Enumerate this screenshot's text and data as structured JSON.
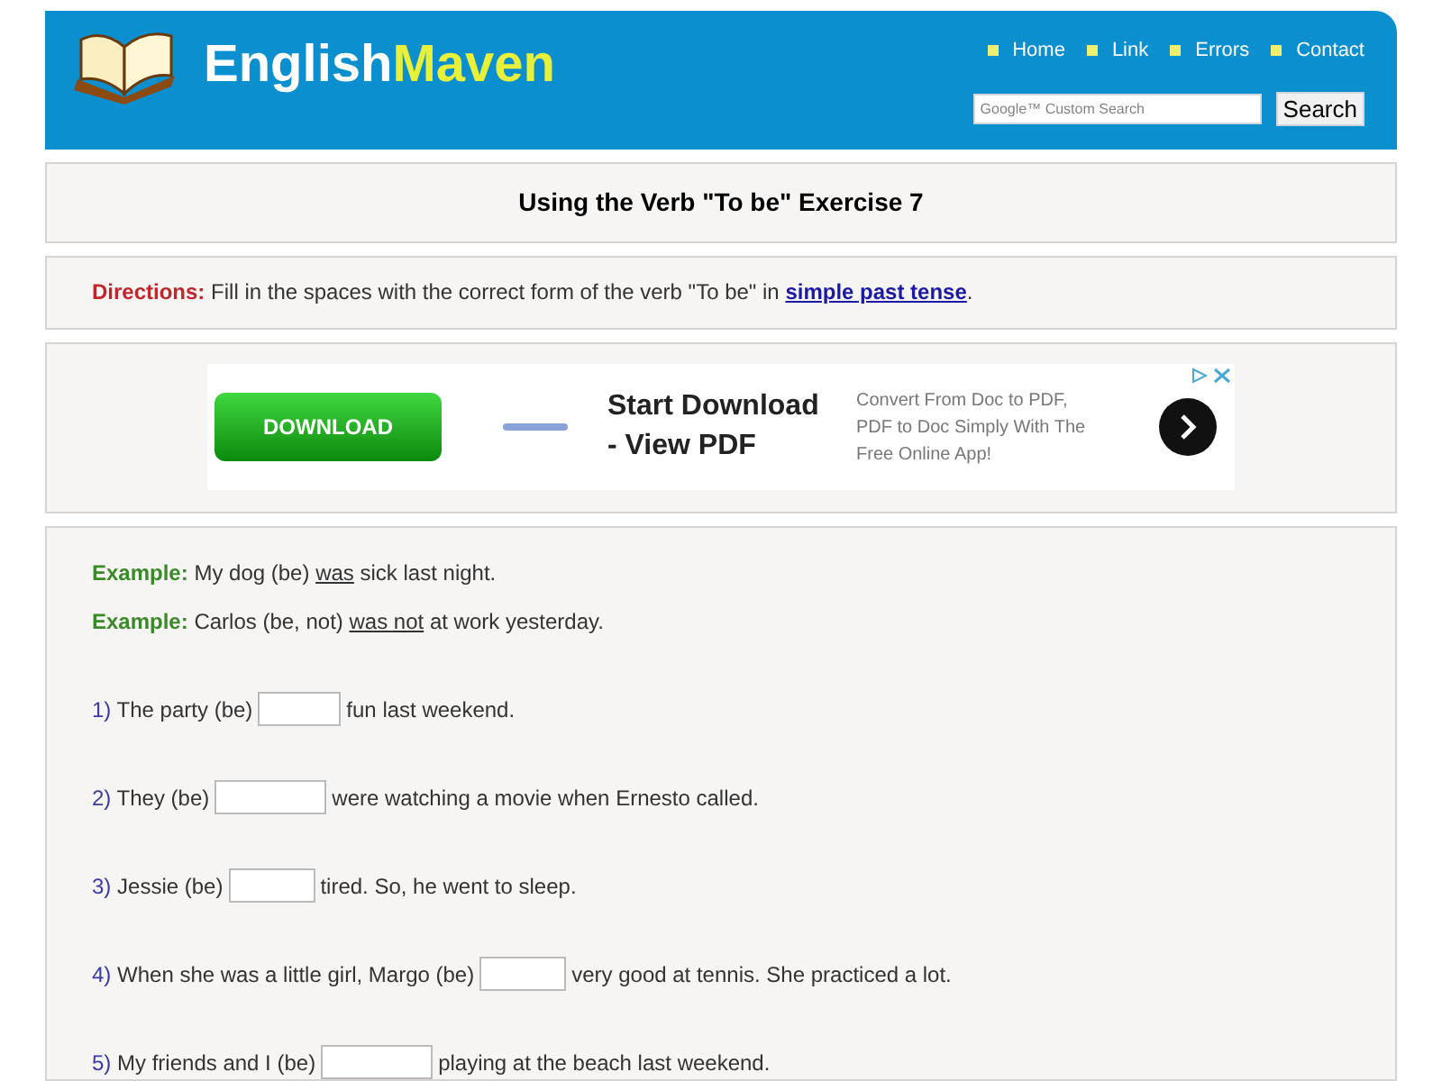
{
  "header": {
    "logo_first": "English",
    "logo_second": "Maven",
    "nav": [
      "Home",
      "Link",
      "Errors",
      "Contact"
    ],
    "search": {
      "placeholder": "Google™ Custom Search",
      "button": "Search"
    }
  },
  "title": "Using the Verb \"To be\" Exercise 7",
  "directions": {
    "label": "Directions:",
    "text": "Fill in the spaces with the correct form of the verb \"To be\" in",
    "link": "simple past tense",
    "end": "."
  },
  "ad": {
    "button": "DOWNLOAD",
    "headline": "Start Download - View PDF",
    "body": "Convert From Doc to PDF, PDF to Doc Simply With The Free Online App!"
  },
  "examples": [
    {
      "label": "Example:",
      "before": "My dog (be)",
      "answer": "was",
      "after": "sick last night."
    },
    {
      "label": "Example:",
      "before": "Carlos (be, not)",
      "answer": "was not",
      "after": "at work yesterday."
    }
  ],
  "questions": [
    {
      "number": "1)",
      "before": "The party (be)",
      "after": "fun last weekend."
    },
    {
      "number": "2)",
      "before": "They (be)",
      "after": "were watching a movie when Ernesto called."
    },
    {
      "number": "3)",
      "before": "Jessie (be)",
      "after": "tired. So, he went to sleep."
    },
    {
      "number": "4)",
      "before": "When she was a little girl, Margo (be)",
      "after": "very good at tennis. She practiced a lot."
    },
    {
      "number": "5)",
      "before": "My friends and I (be)",
      "after": "playing at the beach last weekend."
    }
  ]
}
